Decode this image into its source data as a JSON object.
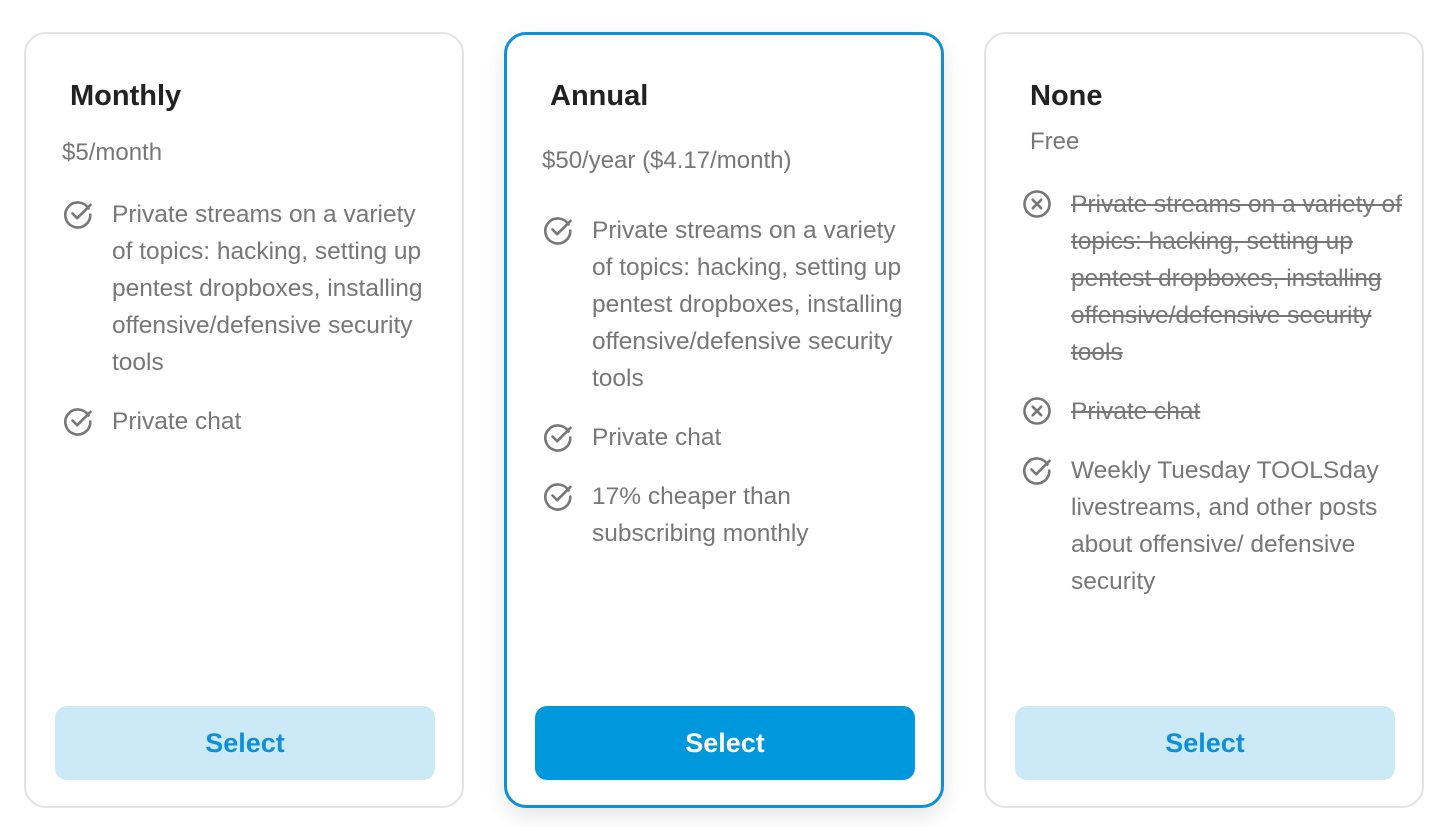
{
  "plans": [
    {
      "title": "Monthly",
      "price": "$5/month",
      "features": [
        {
          "text": "Private streams on a variety of topics: hacking, setting up pentest dropboxes, installing offensive/defensive security tools",
          "included": true,
          "icon": "check-circle-icon"
        },
        {
          "text": "Private chat",
          "included": true,
          "icon": "check-circle-icon"
        }
      ],
      "button_label": "Select"
    },
    {
      "title": "Annual",
      "price": "$50/year ($4.17/month)",
      "features": [
        {
          "text": "Private streams on a variety of topics: hacking, setting up pentest dropboxes, installing offensive/defensive security tools",
          "included": true,
          "icon": "check-circle-icon"
        },
        {
          "text": "Private chat",
          "included": true,
          "icon": "check-circle-icon"
        },
        {
          "text": "17% cheaper than subscribing monthly",
          "included": true,
          "icon": "check-circle-icon"
        }
      ],
      "button_label": "Select"
    },
    {
      "title": "None",
      "price": "Free",
      "features": [
        {
          "text": "Private streams on a variety of topics: hacking, setting up pentest dropboxes, installing offensive/defensive security tools",
          "included": false,
          "icon": "x-circle-icon"
        },
        {
          "text": "Private chat",
          "included": false,
          "icon": "x-circle-icon"
        },
        {
          "text": "Weekly Tuesday TOOLSday livestreams, and other posts about offensive/ defensive security",
          "included": true,
          "icon": "check-circle-icon"
        }
      ],
      "button_label": "Select"
    }
  ],
  "colors": {
    "accent": "#0098dc",
    "accent_light": "#cce9f7",
    "selected_border": "#0f8fd8",
    "text_muted": "#777777",
    "title": "#222222"
  }
}
